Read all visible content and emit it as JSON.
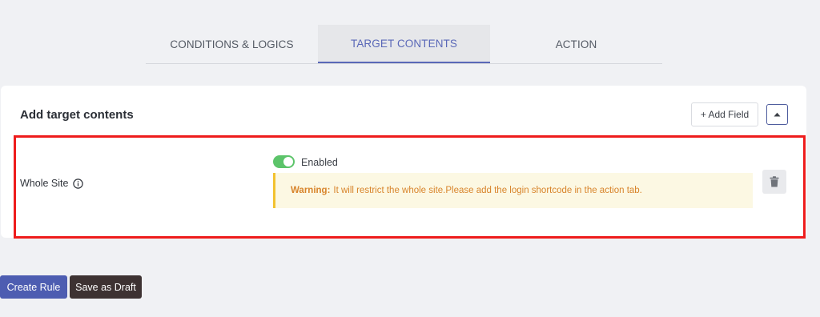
{
  "tabs": [
    {
      "label": "CONDITIONS & LOGICS",
      "active": false
    },
    {
      "label": "TARGET CONTENTS",
      "active": true
    },
    {
      "label": "ACTION",
      "active": false
    }
  ],
  "card": {
    "title": "Add target contents",
    "add_field_label": "+ Add Field",
    "collapse_icon": "caret-up-icon"
  },
  "row": {
    "label": "Whole Site",
    "info_icon": "info-circle-icon",
    "toggle_label": "Enabled",
    "toggle_on": true,
    "warning_prefix": "Warning:",
    "warning_text": "It will restrict the whole site.Please add the login shortcode in the action tab.",
    "delete_icon": "trash-icon"
  },
  "buttons": {
    "create": "Create Rule",
    "draft": "Save as Draft"
  },
  "colors": {
    "accent": "#5a68b8",
    "toggle_on": "#5cc46a",
    "warning_text": "#d8842b",
    "warning_border": "#f2c230",
    "highlight_frame": "#ee1c1c",
    "create_button": "#4d5db1",
    "draft_button": "#3d3232"
  }
}
